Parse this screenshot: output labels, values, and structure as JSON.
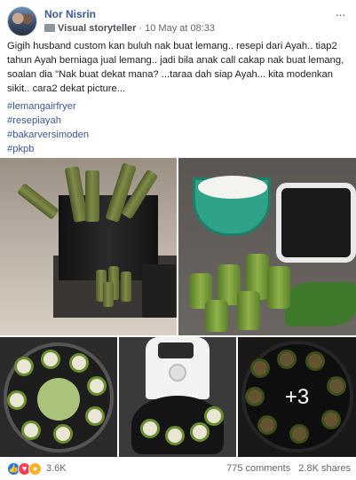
{
  "post": {
    "author": "Nor Nisrin",
    "badge": "Visual storyteller",
    "separator": "·",
    "timestamp": "10 May at 08:33",
    "more_menu": "···",
    "text": "Gigih husband custom kan buluh nak buat lemang.. resepi dari Ayah.. tiap2 tahun Ayah berniaga jual lemang.. jadi bila anak call cakap nak buat lemang, soalan dia \"Nak buat dekat mana? ...taraa dah siap Ayah... kita modenkan sikit.. cara2 dekat picture...",
    "hashtags": [
      "#lemangairfryer",
      "#resepiayah",
      "#bakarversimoden",
      "#pkpb"
    ]
  },
  "photos": {
    "more_count": "+3"
  },
  "footer": {
    "reaction_count": "3.6K",
    "comments": "775 comments",
    "shares": "2.8K shares"
  },
  "icons": {
    "like": "like-icon",
    "love": "love-icon",
    "wow": "wow-icon",
    "more": "more-icon",
    "badge": "badge-icon"
  },
  "colors": {
    "link": "#385898",
    "like": "#1877f2",
    "love": "#f33e58",
    "wow": "#f7b125"
  }
}
